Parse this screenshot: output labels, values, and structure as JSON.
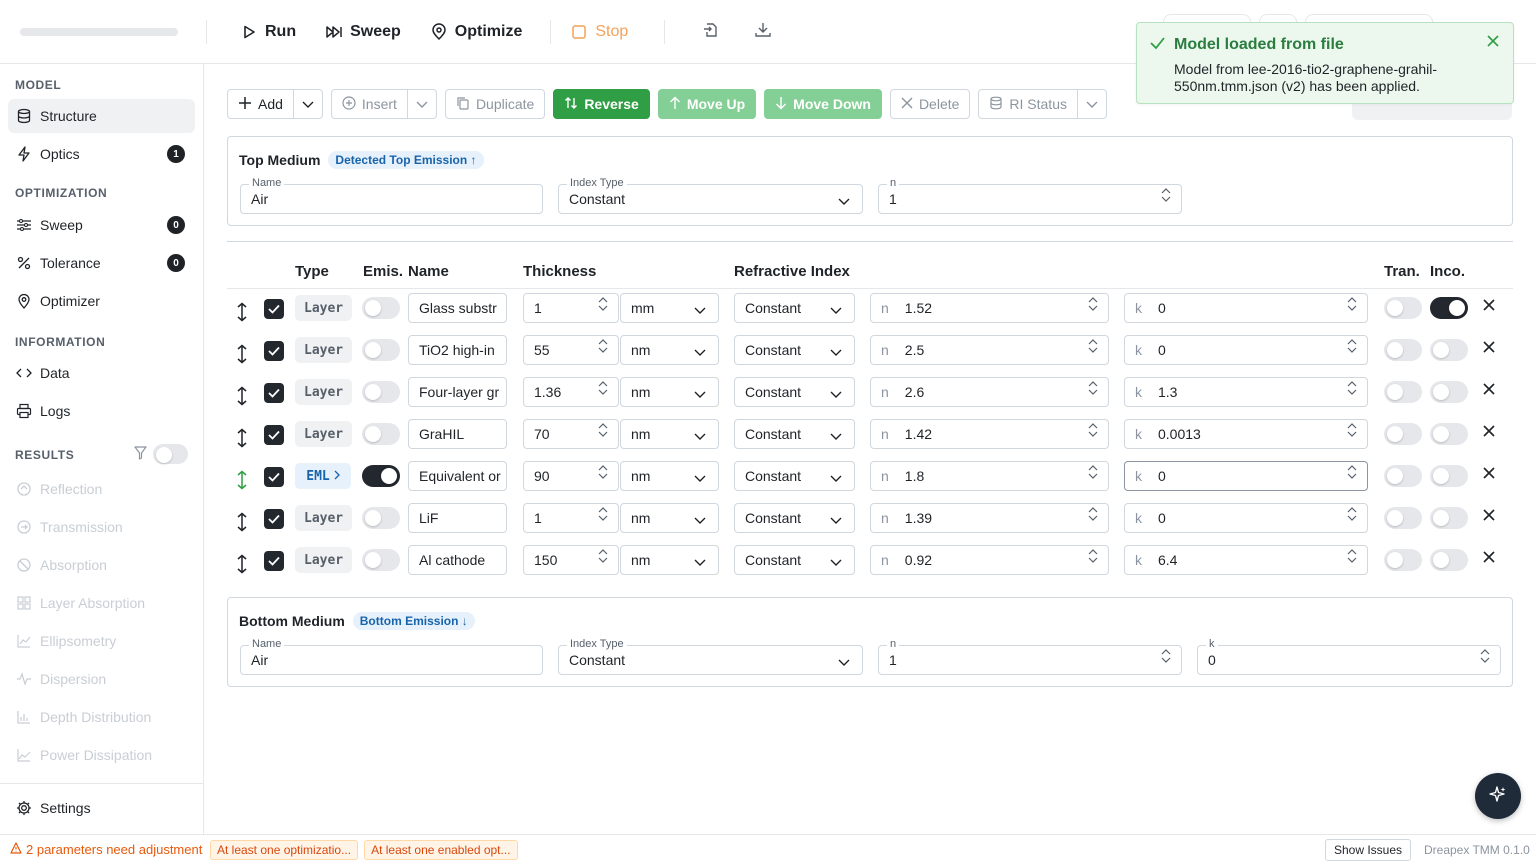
{
  "toolbar": {
    "run": "Run",
    "sweep": "Sweep",
    "optimize": "Optimize",
    "stop": "Stop"
  },
  "toast": {
    "title": "Model loaded from file",
    "message": "Model from lee-2016-tio2-graphene-grahil-550nm.tmm.json (v2) has been applied."
  },
  "sidebar": {
    "model_heading": "MODEL",
    "structure": "Structure",
    "optics": "Optics",
    "optics_count": "1",
    "optimization_heading": "OPTIMIZATION",
    "sweep": "Sweep",
    "sweep_count": "0",
    "tolerance": "Tolerance",
    "tolerance_count": "0",
    "optimizer": "Optimizer",
    "information_heading": "INFORMATION",
    "data": "Data",
    "logs": "Logs",
    "results_heading": "RESULTS",
    "results": [
      "Reflection",
      "Transmission",
      "Absorption",
      "Layer Absorption",
      "Ellipsometry",
      "Dispersion",
      "Depth Distribution",
      "Power Dissipation"
    ],
    "settings": "Settings"
  },
  "actions": {
    "add": "Add",
    "insert": "Insert",
    "duplicate": "Duplicate",
    "reverse": "Reverse",
    "move_up": "Move Up",
    "move_down": "Move Down",
    "delete": "Delete",
    "ri_status": "RI Status"
  },
  "top_medium": {
    "title": "Top Medium",
    "badge": "Detected Top Emission ↑",
    "name_label": "Name",
    "name": "Air",
    "index_type_label": "Index Type",
    "index_type": "Constant",
    "n_label": "n",
    "n": "1"
  },
  "table": {
    "headers": {
      "type": "Type",
      "emis": "Emis.",
      "name": "Name",
      "thickness": "Thickness",
      "ri": "Refractive Index",
      "tran": "Tran.",
      "inco": "Inco."
    },
    "rows": [
      {
        "type": "Layer",
        "emission": false,
        "name": "Glass substr",
        "thickness": "1",
        "unit": "mm",
        "index_type": "Constant",
        "n": "1.52",
        "k": "0",
        "tran": false,
        "inco": true
      },
      {
        "type": "Layer",
        "emission": false,
        "name": "TiO2 high-in",
        "thickness": "55",
        "unit": "nm",
        "index_type": "Constant",
        "n": "2.5",
        "k": "0",
        "tran": false,
        "inco": false
      },
      {
        "type": "Layer",
        "emission": false,
        "name": "Four-layer gr",
        "thickness": "1.36",
        "unit": "nm",
        "index_type": "Constant",
        "n": "2.6",
        "k": "1.3",
        "tran": false,
        "inco": false
      },
      {
        "type": "Layer",
        "emission": false,
        "name": "GraHIL",
        "thickness": "70",
        "unit": "nm",
        "index_type": "Constant",
        "n": "1.42",
        "k": "0.0013",
        "tran": false,
        "inco": false
      },
      {
        "type": "EML",
        "emission": true,
        "name": "Equivalent or",
        "thickness": "90",
        "unit": "nm",
        "index_type": "Constant",
        "n": "1.8",
        "k": "0",
        "tran": false,
        "inco": false
      },
      {
        "type": "Layer",
        "emission": false,
        "name": "LiF",
        "thickness": "1",
        "unit": "nm",
        "index_type": "Constant",
        "n": "1.39",
        "k": "0",
        "tran": false,
        "inco": false
      },
      {
        "type": "Layer",
        "emission": false,
        "name": "Al cathode",
        "thickness": "150",
        "unit": "nm",
        "index_type": "Constant",
        "n": "0.92",
        "k": "6.4",
        "tran": false,
        "inco": false
      }
    ]
  },
  "bottom_medium": {
    "title": "Bottom Medium",
    "badge": "Bottom Emission ↓",
    "name_label": "Name",
    "name": "Air",
    "index_type_label": "Index Type",
    "index_type": "Constant",
    "n_label": "n",
    "n": "1",
    "k_label": "k",
    "k": "0"
  },
  "status": {
    "warning": "2 parameters need adjustment",
    "chip1": "At least one optimizatio...",
    "chip2": "At least one enabled opt...",
    "show_issues": "Show Issues",
    "version": "Dreapex TMM 0.1.0"
  },
  "colors": {
    "accent_green": "#2f9e44",
    "warning_orange": "#e8590c",
    "badge_blue": "#1864ab"
  }
}
